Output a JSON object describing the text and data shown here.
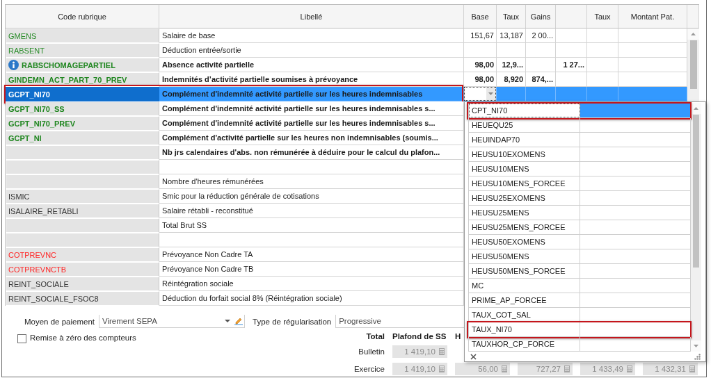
{
  "grid": {
    "columns": {
      "code": "Code rubrique",
      "libelle": "Libellé",
      "base": "Base",
      "taux": "Taux",
      "gains": "Gains",
      "taux_pat": "Taux",
      "montant_pat": "Montant Pat."
    },
    "rows": [
      {
        "code": "GMENS",
        "color": "#2a8c2a",
        "label": "Salaire de base",
        "bold": false,
        "info": false,
        "selected": false,
        "highlighted": false,
        "values": {
          "base": "151,67",
          "taux": "13,187",
          "gains": "2 00..."
        }
      },
      {
        "code": "RABSENT",
        "color": "#2a8c2a",
        "label": "Déduction entrée/sortie",
        "bold": false,
        "info": false,
        "selected": false,
        "highlighted": false
      },
      {
        "code": "RABSCHOMAGEPARTIEL",
        "color": "#1f861f",
        "label": "Absence activité partielle",
        "bold": true,
        "info": true,
        "selected": false,
        "highlighted": false,
        "values": {
          "base": "98,00",
          "taux": "12,9...",
          "column_6": "1 27..."
        }
      },
      {
        "code": "GINDEMN_ACT_PART_70_PREV",
        "color": "#1f861f",
        "label": "Indemnités d’activité partielle soumises à prévoyance",
        "bold": true,
        "info": false,
        "selected": false,
        "highlighted": false,
        "values": {
          "base": "98,00",
          "taux": "8,920",
          "gains": "874,..."
        }
      },
      {
        "code": "GCPT_NI70",
        "label": "Complément d'indemnité activité partielle sur les heures indemnisables",
        "bold": true,
        "info": false,
        "selected": true,
        "highlighted": true
      },
      {
        "code": "GCPT_NI70_SS",
        "color": "#1f861f",
        "label": "Complément d'indemnité activité partielle sur les heures indemnisables s...",
        "bold": true,
        "info": false,
        "selected": false,
        "highlighted": false
      },
      {
        "code": "GCPT_NI70_PREV",
        "color": "#1f861f",
        "label": "Complément d'indemnité activité partielle sur les heures indemnisables s...",
        "bold": true,
        "info": false,
        "selected": false,
        "highlighted": false
      },
      {
        "code": "GCPT_NI",
        "color": "#1f861f",
        "label": "Complément d'activité partielle sur les heures non indemnisables (soumis...",
        "bold": true,
        "info": false,
        "selected": false,
        "highlighted": false
      },
      {
        "label": "Nb jrs calendaires d'abs. non rémunérée à déduire pour le calcul du plafon...",
        "bold": true,
        "info": false,
        "selected": false,
        "highlighted": false
      },
      {
        "info": false,
        "selected": false,
        "highlighted": false
      },
      {
        "label": "Nombre d'heures rémunérées",
        "bold": false,
        "info": false,
        "selected": false,
        "highlighted": false
      },
      {
        "code": "ISMIC",
        "color": "#333333",
        "label": "Smic pour la réduction générale de cotisations",
        "bold": false,
        "info": false,
        "selected": false,
        "highlighted": false
      },
      {
        "code": "ISALAIRE_RETABLI",
        "color": "#333333",
        "label": "Salaire rétabli - reconstitué",
        "bold": false,
        "info": false,
        "selected": false,
        "highlighted": false
      },
      {
        "label": "Total Brut SS",
        "bold": false,
        "info": false,
        "selected": false,
        "highlighted": false
      },
      {
        "info": false,
        "selected": false,
        "highlighted": false
      },
      {
        "code": "COTPREVNC",
        "color": "#ff2424",
        "label": "Prévoyance Non Cadre TA",
        "bold": false,
        "info": false,
        "selected": false,
        "highlighted": false
      },
      {
        "code": "COTPREVNCTB",
        "color": "#ff2424",
        "label": "Prévoyance Non Cadre TB",
        "bold": false,
        "info": false,
        "selected": false,
        "highlighted": false
      },
      {
        "code": "REINT_SOCIALE",
        "color": "#333333",
        "label": "Réintégration sociale",
        "bold": false,
        "info": false,
        "selected": false,
        "highlighted": false
      },
      {
        "code": "REINT_SOCIALE_FSOC8",
        "color": "#333333",
        "label": "Déduction du forfait social 8% (Réintégration sociale)",
        "bold": false,
        "info": false,
        "selected": false,
        "highlighted": false
      }
    ]
  },
  "dropdown": {
    "items": [
      {
        "label": "CPT_NI70",
        "selected": true,
        "highlighted": true
      },
      {
        "label": "HEUEQU25",
        "selected": false,
        "highlighted": false
      },
      {
        "label": "HEUINDAP70",
        "selected": false,
        "highlighted": false
      },
      {
        "label": "HEUSU10EXOMENS",
        "selected": false,
        "highlighted": false
      },
      {
        "label": "HEUSU10MENS",
        "selected": false,
        "highlighted": false
      },
      {
        "label": "HEUSU10MENS_FORCEE",
        "selected": false,
        "highlighted": false
      },
      {
        "label": "HEUSU25EXOMENS",
        "selected": false,
        "highlighted": false
      },
      {
        "label": "HEUSU25MENS",
        "selected": false,
        "highlighted": false
      },
      {
        "label": "HEUSU25MENS_FORCEE",
        "selected": false,
        "highlighted": false
      },
      {
        "label": "HEUSU50EXOMENS",
        "selected": false,
        "highlighted": false
      },
      {
        "label": "HEUSU50MENS",
        "selected": false,
        "highlighted": false
      },
      {
        "label": "HEUSU50MENS_FORCEE",
        "selected": false,
        "highlighted": false
      },
      {
        "label": "MC",
        "selected": false,
        "highlighted": false
      },
      {
        "label": "PRIME_AP_FORCEE",
        "selected": false,
        "highlighted": false
      },
      {
        "label": "TAUX_COT_SAL",
        "selected": false,
        "highlighted": false
      },
      {
        "label": "TAUX_NI70",
        "selected": false,
        "highlighted": true
      },
      {
        "label": "TAUXHOR_CP_FORCE",
        "selected": false,
        "highlighted": false
      }
    ]
  },
  "payment": {
    "label": "Moyen de paiement",
    "value": "Virement SEPA"
  },
  "regularisation": {
    "label": "Type de régularisation",
    "value": "Progressive"
  },
  "reset_counters": {
    "label": "Remise à zéro des compteurs",
    "checked": false
  },
  "totals": {
    "title": "Total",
    "columns": [
      "Plafond de SS",
      "H"
    ],
    "rows": [
      {
        "label": "Bulletin",
        "values": [
          "1 419,10"
        ]
      },
      {
        "label": "Exercice",
        "values": [
          "1 419,10",
          "56,00",
          "727,27",
          "1 433,49",
          "1 432,31"
        ]
      }
    ]
  }
}
